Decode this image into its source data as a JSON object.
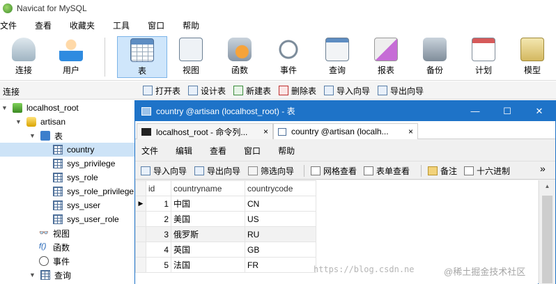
{
  "app": {
    "title": "Navicat for MySQL"
  },
  "menu": [
    "文件",
    "查看",
    "收藏夹",
    "工具",
    "窗口",
    "帮助"
  ],
  "toolbar": {
    "items": [
      {
        "label": "连接",
        "icon": "connection-icon"
      },
      {
        "label": "用户",
        "icon": "user-icon"
      },
      {
        "label": "表",
        "icon": "table-icon"
      },
      {
        "label": "视图",
        "icon": "view-icon"
      },
      {
        "label": "函数",
        "icon": "function-icon"
      },
      {
        "label": "事件",
        "icon": "event-icon"
      },
      {
        "label": "查询",
        "icon": "query-icon"
      },
      {
        "label": "报表",
        "icon": "report-icon"
      },
      {
        "label": "备份",
        "icon": "backup-icon"
      },
      {
        "label": "计划",
        "icon": "schedule-icon"
      },
      {
        "label": "模型",
        "icon": "model-icon"
      }
    ]
  },
  "subbar": {
    "label": "连接",
    "buttons": [
      "打开表",
      "设计表",
      "新建表",
      "删除表",
      "导入向导",
      "导出向导"
    ]
  },
  "tree": {
    "connection": "localhost_root",
    "database": "artisan",
    "tables_folder": "表",
    "tables": [
      "country",
      "sys_privilege",
      "sys_role",
      "sys_role_privilege",
      "sys_user",
      "sys_user_role"
    ],
    "others": [
      "视图",
      "函数",
      "事件",
      "查询"
    ]
  },
  "child": {
    "title": "country @artisan (localhost_root) - 表",
    "controls": {
      "minimize": "—",
      "maximize": "☐",
      "close": "✕"
    },
    "tabs": [
      {
        "label": "localhost_root - 命令列...",
        "close": "×"
      },
      {
        "label": "country @artisan (localh...",
        "close": "×"
      }
    ],
    "menu": [
      "文件",
      "编辑",
      "查看",
      "窗口",
      "帮助"
    ],
    "toolbar": [
      "导入向导",
      "导出向导",
      "筛选向导",
      "网格查看",
      "表单查看",
      "备注",
      "十六进制"
    ],
    "more": "»",
    "grid": {
      "columns": [
        "id",
        "countryname",
        "countrycode"
      ],
      "rows": [
        [
          "1",
          "中国",
          "CN"
        ],
        [
          "2",
          "美国",
          "US"
        ],
        [
          "3",
          "俄罗斯",
          "RU"
        ],
        [
          "4",
          "英国",
          "GB"
        ],
        [
          "5",
          "法国",
          "FR"
        ]
      ]
    }
  },
  "watermark": {
    "url": "https://blog.csdn.ne",
    "site": "@稀土掘金技术社区"
  }
}
